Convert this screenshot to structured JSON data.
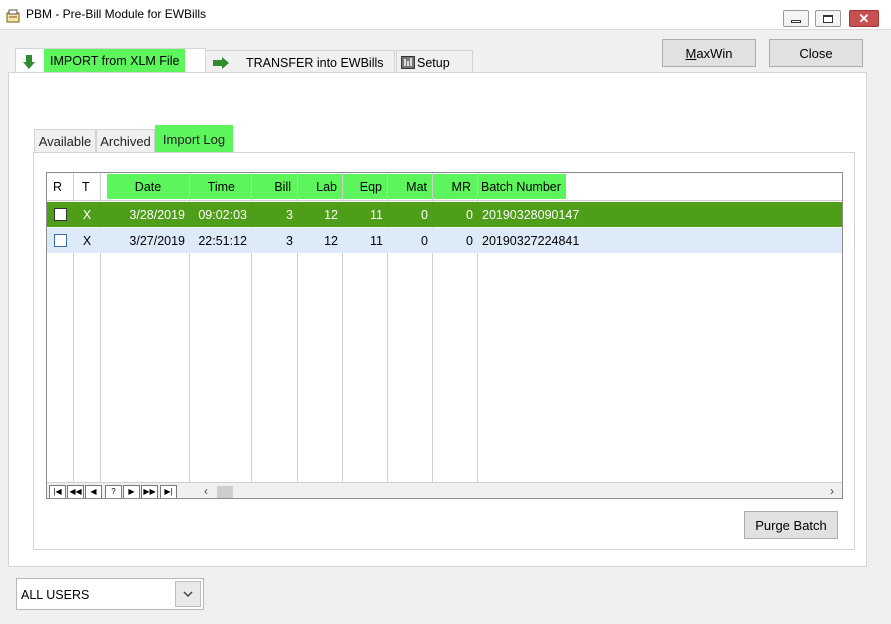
{
  "window": {
    "title": "PBM - Pre-Bill Module for EWBills"
  },
  "main_tabs": [
    {
      "label": "IMPORT from XLM File",
      "icon": "arrow-down-icon",
      "active": true
    },
    {
      "label": "TRANSFER into EWBills",
      "icon": "arrow-right-icon"
    },
    {
      "label": "Setup",
      "icon": "setup-icon"
    }
  ],
  "buttons": {
    "maxwin": "MaxWin",
    "maxwin_accel": "M",
    "maxwin_rest": "axWin",
    "close": "Close",
    "purge": "Purge Batch"
  },
  "sub_tabs": [
    {
      "label": "Available"
    },
    {
      "label": "Archived"
    },
    {
      "label": "Import Log",
      "active": true
    }
  ],
  "grid": {
    "columns": [
      "R",
      "T",
      "Date",
      "Time",
      "Bill",
      "Lab",
      "Eqp",
      "Mat",
      "MR",
      "Batch Number"
    ],
    "rows": [
      {
        "r": false,
        "t": "X",
        "date": "3/28/2019",
        "time": "09:02:03",
        "bill": "3",
        "lab": "12",
        "eqp": "11",
        "mat": "0",
        "mr": "0",
        "batch": "20190328090147",
        "selected": true
      },
      {
        "r": false,
        "t": "X",
        "date": "3/27/2019",
        "time": "22:51:12",
        "bill": "3",
        "lab": "12",
        "eqp": "11",
        "mat": "0",
        "mr": "0",
        "batch": "20190327224841"
      }
    ],
    "nav": [
      "|◀",
      "◀◀",
      "◀",
      "?",
      "▶",
      "▶▶",
      "▶|"
    ]
  },
  "users_filter": {
    "value": "ALL USERS"
  },
  "colors": {
    "highlight": "#5cf55c",
    "selected_row": "#4e9e1a",
    "alt_row": "#ddeaf8"
  }
}
